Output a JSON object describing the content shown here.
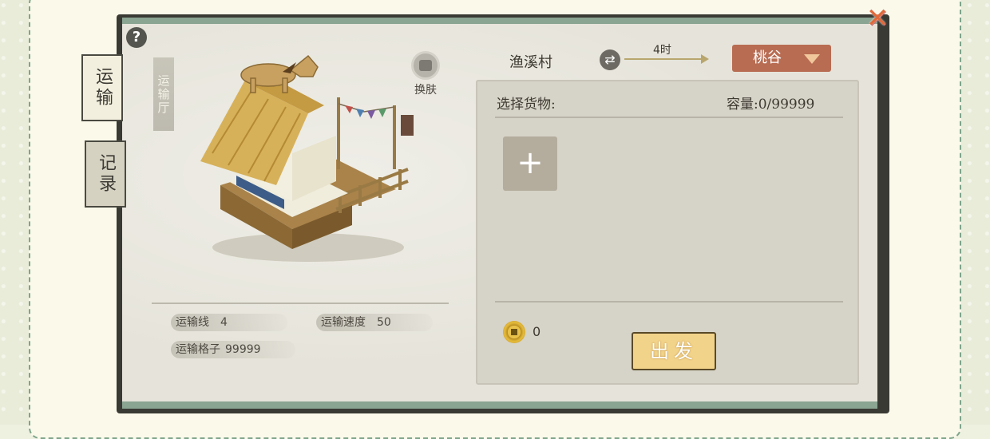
{
  "tabs": [
    {
      "label": "运输",
      "active": true
    },
    {
      "label": "记录",
      "active": false
    }
  ],
  "building": {
    "hall_label": "运输厅",
    "skin_label": "换肤"
  },
  "stats": {
    "line_label": "运输线",
    "line_value": "4",
    "speed_label": "运输速度",
    "speed_value": "50",
    "slots_label": "运输格子",
    "slots_value": "99999"
  },
  "route": {
    "from": "渔溪村",
    "time": "4时",
    "destination": "桃谷"
  },
  "goods": {
    "title": "选择货物:",
    "capacity_label": "容量:",
    "capacity_value": "0/99999",
    "add_symbol": "+"
  },
  "cost": {
    "value": "0"
  },
  "depart_label": "出发",
  "help_symbol": "?",
  "close_symbol": "✕",
  "swap_symbol": "⇄",
  "colors": {
    "frame_green": "#8aa592",
    "dropdown": "#b86c52",
    "depart_button": "#f2d38a",
    "close": "#e06a3a"
  },
  "icons": [
    "help-icon",
    "close-icon",
    "skin-icon",
    "swap-icon",
    "coin-icon",
    "plus-icon",
    "dropdown-caret-icon"
  ]
}
